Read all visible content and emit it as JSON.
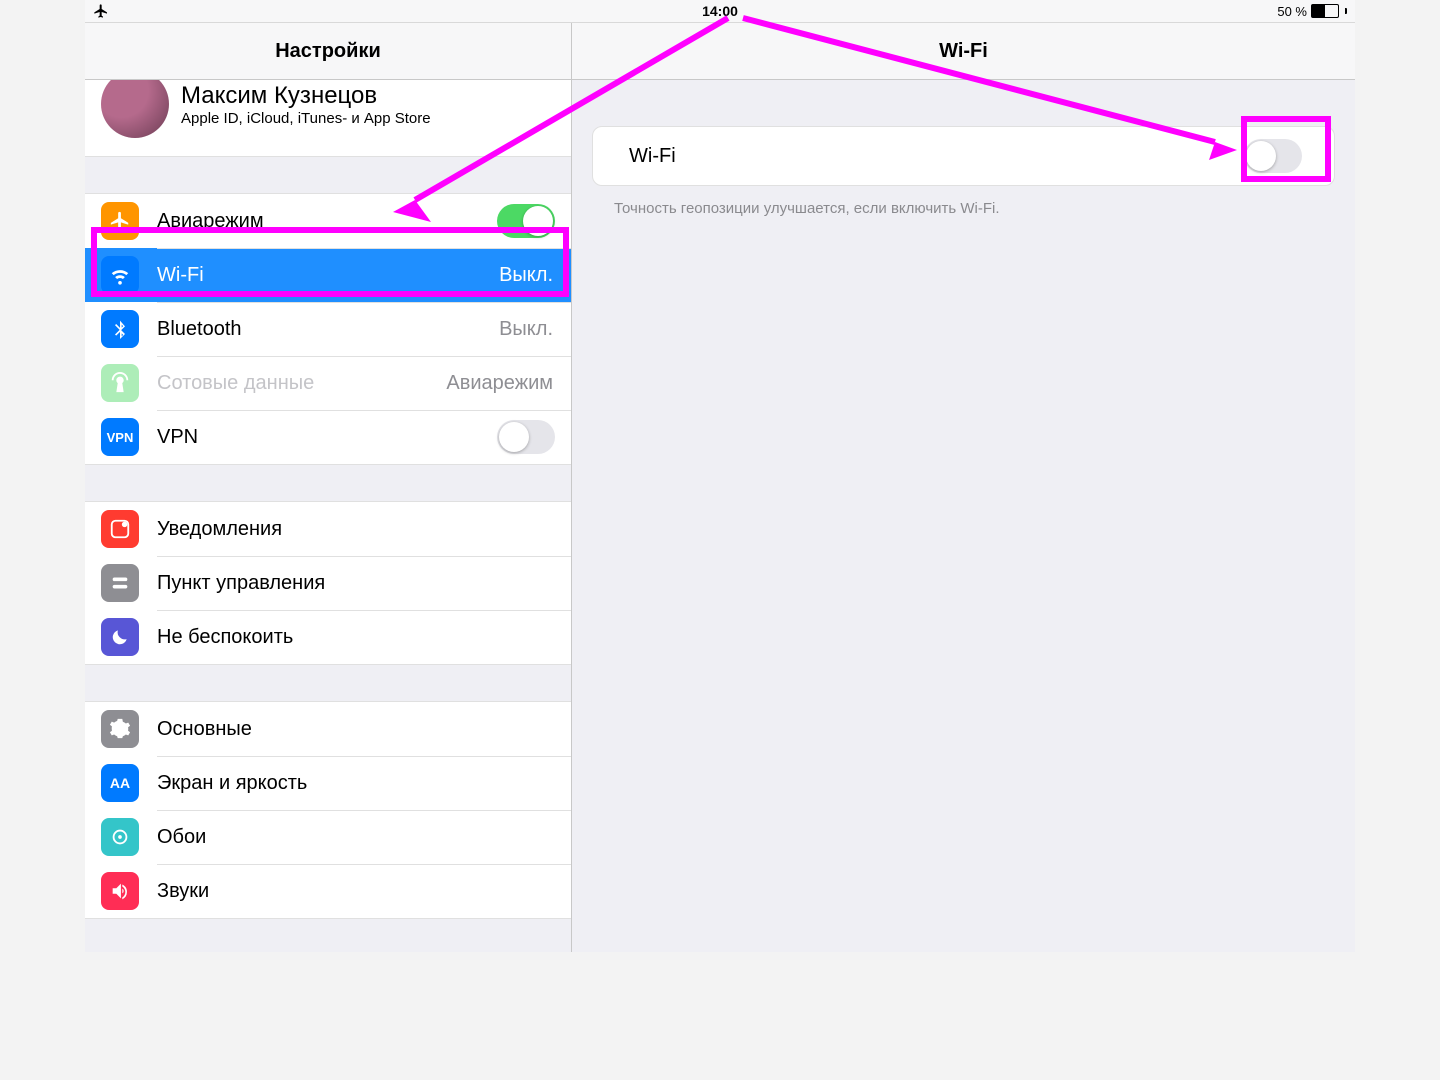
{
  "statusbar": {
    "time": "14:00",
    "battery_text": "50 %",
    "battery_level": 0.5
  },
  "sidebar": {
    "title": "Настройки",
    "account": {
      "name": "Максим Кузнецов",
      "subtitle": "Apple ID, iCloud, iTunes- и App Store"
    },
    "group1": [
      {
        "label": "Авиарежим",
        "kind": "toggle",
        "on": true,
        "icon": "airplane"
      },
      {
        "label": "Wi-Fi",
        "value": "Выкл.",
        "selected": true,
        "icon": "wifi"
      },
      {
        "label": "Bluetooth",
        "value": "Выкл.",
        "icon": "bt"
      },
      {
        "label": "Сотовые данные",
        "value": "Авиарежим",
        "disabled": true,
        "icon": "cell"
      },
      {
        "label": "VPN",
        "kind": "toggle",
        "on": false,
        "icon": "vpn"
      }
    ],
    "group2": [
      {
        "label": "Уведомления",
        "icon": "notif"
      },
      {
        "label": "Пункт управления",
        "icon": "cc"
      },
      {
        "label": "Не беспокоить",
        "icon": "dnd"
      }
    ],
    "group3": [
      {
        "label": "Основные",
        "icon": "general"
      },
      {
        "label": "Экран и яркость",
        "icon": "display"
      },
      {
        "label": "Обои",
        "icon": "wall"
      },
      {
        "label": "Звуки",
        "icon": "sound"
      }
    ]
  },
  "detail": {
    "title": "Wi-Fi",
    "toggle_label": "Wi-Fi",
    "toggle_on": false,
    "hint": "Точность геопозиции улучшается, если включить Wi-Fi."
  }
}
